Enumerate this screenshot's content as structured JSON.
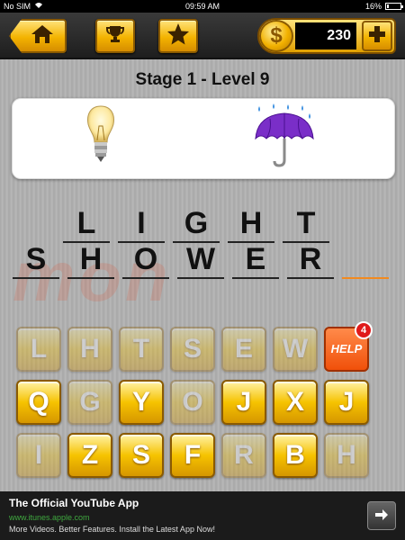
{
  "status_bar": {
    "carrier": "No SIM",
    "time": "09:59 AM",
    "battery": "16%"
  },
  "header": {
    "coins": "230",
    "icons": {
      "home": "home-icon",
      "trophy": "trophy-icon",
      "star": "star-icon",
      "coin": "dollar-coin-icon",
      "plus": "plus-icon"
    },
    "coin_symbol": "$"
  },
  "stage": {
    "title": "Stage 1 - Level 9"
  },
  "clues": [
    {
      "name": "light-bulb-emoji"
    },
    {
      "name": "umbrella-rain-emoji"
    }
  ],
  "answer": {
    "word1": [
      "L",
      "I",
      "G",
      "H",
      "T"
    ],
    "word2": [
      "S",
      "H",
      "O",
      "W",
      "E",
      "R",
      ""
    ]
  },
  "keyboard": {
    "row1": [
      {
        "letter": "L",
        "used": true
      },
      {
        "letter": "H",
        "used": true
      },
      {
        "letter": "T",
        "used": true
      },
      {
        "letter": "S",
        "used": true
      },
      {
        "letter": "E",
        "used": true
      },
      {
        "letter": "W",
        "used": true
      }
    ],
    "row2": [
      {
        "letter": "Q",
        "used": false
      },
      {
        "letter": "G",
        "used": true
      },
      {
        "letter": "Y",
        "used": false
      },
      {
        "letter": "O",
        "used": true
      },
      {
        "letter": "J",
        "used": false
      },
      {
        "letter": "X",
        "used": false
      },
      {
        "letter": "J",
        "used": false
      }
    ],
    "row3": [
      {
        "letter": "I",
        "used": true
      },
      {
        "letter": "Z",
        "used": false
      },
      {
        "letter": "S",
        "used": false
      },
      {
        "letter": "F",
        "used": false
      },
      {
        "letter": "R",
        "used": true
      },
      {
        "letter": "B",
        "used": false
      },
      {
        "letter": "H",
        "used": true
      }
    ],
    "help": {
      "label": "HELP",
      "count": "4"
    }
  },
  "ad": {
    "title": "The Official YouTube App",
    "url": "www.itunes.apple.com",
    "description": "More Videos. Better Features. Install the Latest App Now!",
    "arrow_icon": "arrow-right-icon"
  },
  "colors": {
    "gold": "#f3b300",
    "help": "#f0500a",
    "underline_empty": "#f28a1f"
  }
}
